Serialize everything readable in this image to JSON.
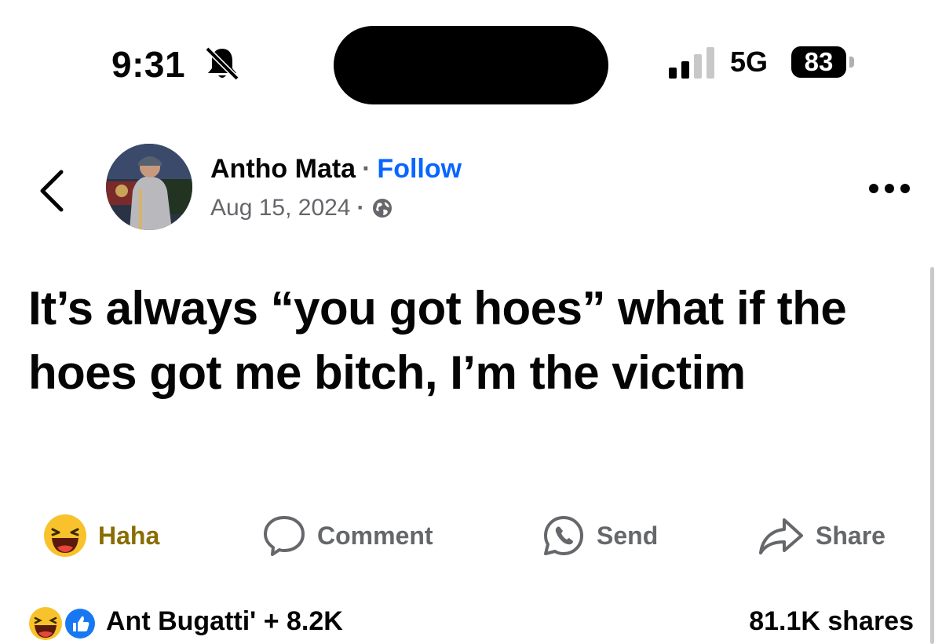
{
  "status_bar": {
    "time": "9:31",
    "network": "5G",
    "battery": "83",
    "battery_percent": 83,
    "signal_bars_filled": 2,
    "signal_bars_total": 4
  },
  "post": {
    "author": "Antho Mata",
    "follow_label": "Follow",
    "date": "Aug 15, 2024",
    "separator": "·",
    "text": "It’s always “you got hoes” what if the hoes got me bitch, I’m the victim"
  },
  "actions": {
    "haha": "Haha",
    "comment": "Comment",
    "send": "Send",
    "share": "Share"
  },
  "footer": {
    "reactions_text": "Ant Bugatti' + 8.2K",
    "shares_text": "81.1K shares"
  },
  "colors": {
    "follow": "#0866ff",
    "haha_selected": "#8a6d00",
    "secondary": "#65676b",
    "like_blue": "#1877f2",
    "haha_yellow": "#f7c22c"
  },
  "icons": [
    "bell-slash-icon",
    "signal-icon",
    "battery-icon",
    "back-chevron-icon",
    "globe-icon",
    "more-icon",
    "haha-emoji-icon",
    "comment-icon",
    "send-icon",
    "share-icon",
    "like-reaction-icon"
  ]
}
